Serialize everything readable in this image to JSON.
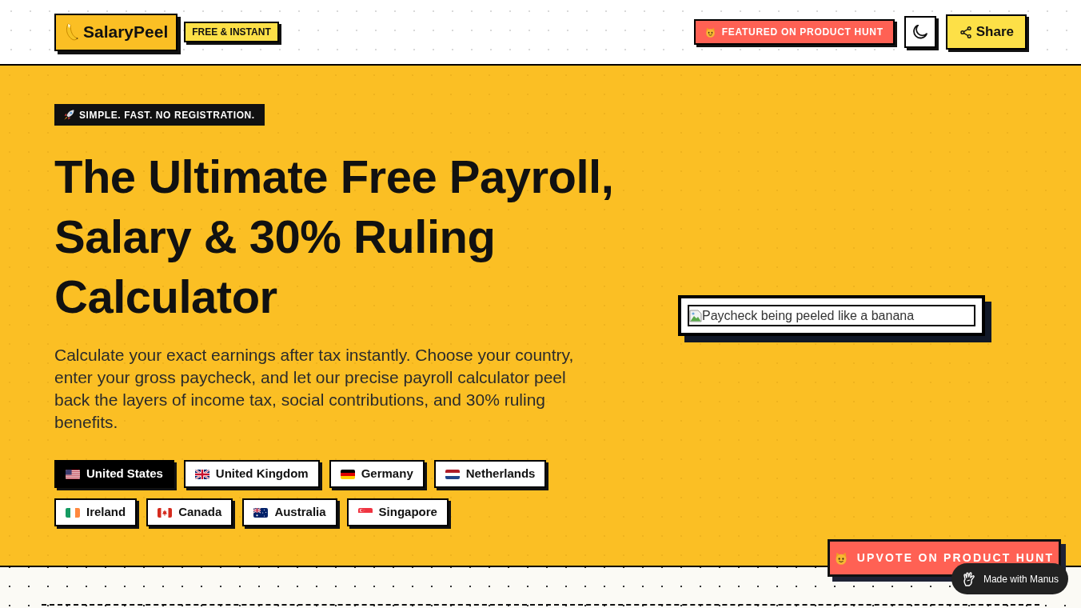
{
  "header": {
    "logo": "SalaryPeel",
    "tag": "FREE & INSTANT",
    "featured_link": "FEATURED ON PRODUCT HUNT",
    "share_button": "Share"
  },
  "hero": {
    "tagline": "SIMPLE. FAST. NO REGISTRATION.",
    "title": "The Ultimate Free Payroll, Salary & 30% Ruling Calculator",
    "description": "Calculate your exact earnings after tax instantly. Choose your country, enter your gross paycheck, and let our precise payroll calculator peel back the layers of income tax, social contributions, and 30% ruling benefits.",
    "countries": [
      {
        "label": "United States",
        "kind": "us",
        "selected": true
      },
      {
        "label": "United Kingdom",
        "kind": "gb",
        "selected": false
      },
      {
        "label": "Germany",
        "kind": "de",
        "selected": false
      },
      {
        "label": "Netherlands",
        "kind": "nl",
        "selected": false
      },
      {
        "label": "Ireland",
        "kind": "ie",
        "selected": false
      },
      {
        "label": "Canada",
        "kind": "ca",
        "selected": false
      },
      {
        "label": "Australia",
        "kind": "au",
        "selected": false
      },
      {
        "label": "Singapore",
        "kind": "sg",
        "selected": false
      }
    ],
    "image": {
      "alt_text": "Paycheck being peeled like a banana"
    }
  },
  "upvote_button": "UPVOTE ON PRODUCT HUNT",
  "made_with_badge": "Made with Manus"
}
